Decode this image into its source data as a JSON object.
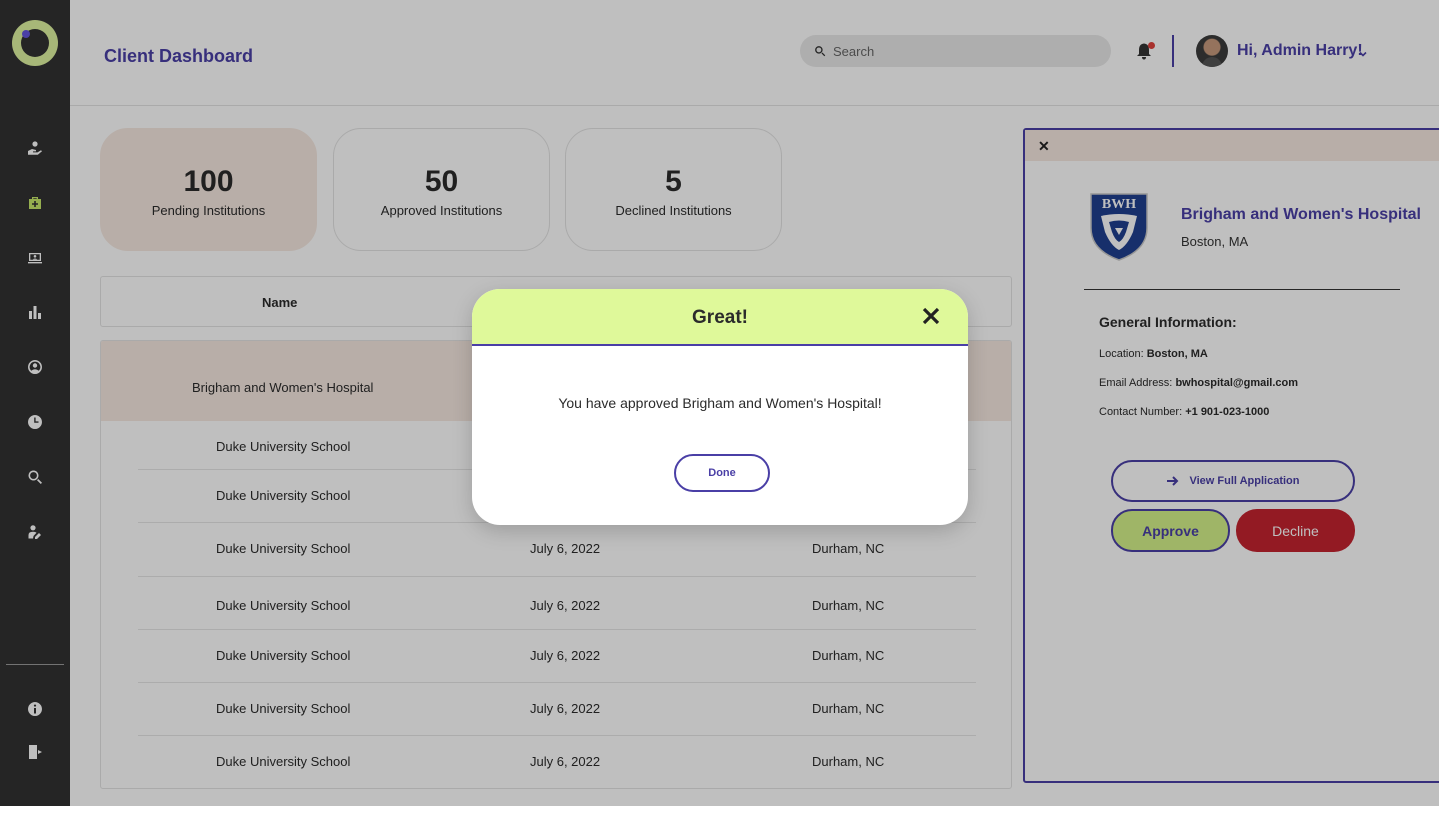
{
  "header": {
    "title": "Client Dashboard",
    "search_placeholder": "Search",
    "user_greeting": "Hi, Admin Harry!"
  },
  "sidebar": {
    "icons": [
      "hand-heart-icon",
      "medical-kit-icon",
      "computer-icon",
      "bar-chart-icon",
      "user-circle-icon",
      "clock-icon",
      "search-icon",
      "person-edit-icon"
    ],
    "active_index": 1,
    "bottom_icons": [
      "info-icon",
      "logout-icon"
    ]
  },
  "stats": [
    {
      "value": "100",
      "label": "Pending Institutions"
    },
    {
      "value": "50",
      "label": "Approved Institutions"
    },
    {
      "value": "5",
      "label": "Declined Institutions"
    }
  ],
  "table": {
    "columns": [
      "Name"
    ],
    "rows": [
      {
        "name": "Brigham and Women's Hospital",
        "date": "",
        "location": ""
      },
      {
        "name": "Duke University School",
        "date": "",
        "location": ""
      },
      {
        "name": "Duke University School",
        "date": "",
        "location": ""
      },
      {
        "name": "Duke University School",
        "date": "July 6, 2022",
        "location": "Durham, NC"
      },
      {
        "name": "Duke University School",
        "date": "July 6, 2022",
        "location": "Durham, NC"
      },
      {
        "name": "Duke University School",
        "date": "July 6, 2022",
        "location": "Durham, NC"
      },
      {
        "name": "Duke University School",
        "date": "July 6, 2022",
        "location": "Durham, NC"
      },
      {
        "name": "Duke University School",
        "date": "July 6, 2022",
        "location": "Durham, NC"
      }
    ]
  },
  "panel": {
    "close": "✕",
    "crest_text": "BWH",
    "name": "Brigham and Women's Hospital",
    "location": "Boston, MA",
    "general_title": "General Information:",
    "location_label": "Location:",
    "location_value": "Boston, MA",
    "email_label": "Email Address:",
    "email_value": "bwhospital@gmail.com",
    "contact_label": "Contact Number:",
    "contact_value": "+1 901-023-1000",
    "view_label": "View Full Application",
    "approve_label": "Approve",
    "decline_label": "Decline"
  },
  "modal": {
    "title": "Great!",
    "message": "You have approved Brigham and Women's Hospital!",
    "done_label": "Done"
  },
  "colors": {
    "accent": "#4a3fa6",
    "lime": "#d5f28a",
    "decline": "#c4232f",
    "sidebar": "#323232",
    "pending_bg": "#f6e9e1"
  }
}
